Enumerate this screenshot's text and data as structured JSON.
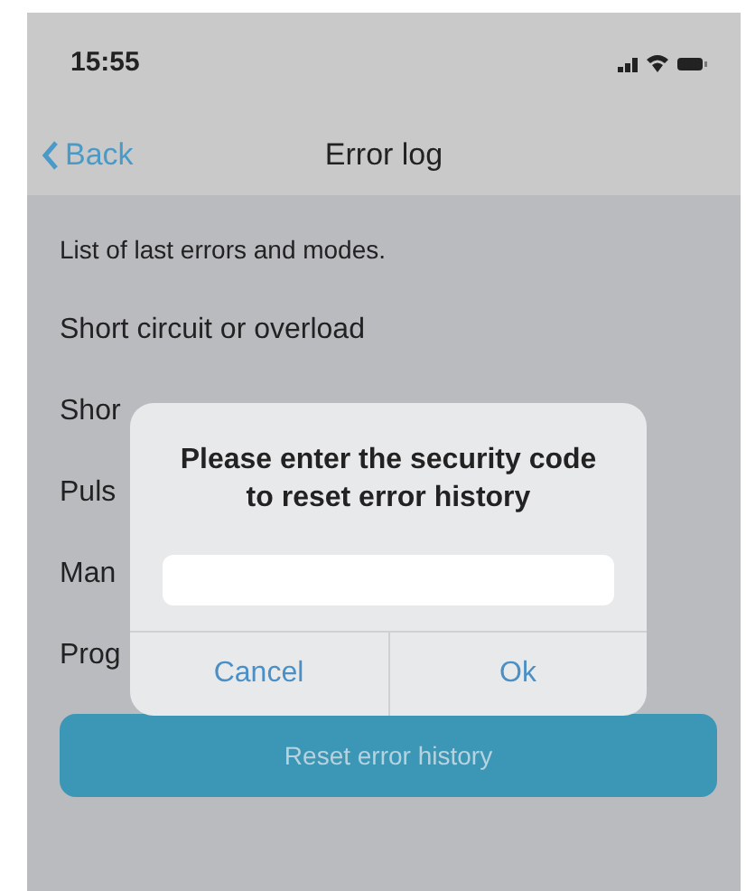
{
  "status_bar": {
    "time": "15:55"
  },
  "nav": {
    "back": "Back",
    "title": "Error log"
  },
  "intro": "List of last errors and modes.",
  "items": [
    {
      "label": "Short circuit or overload"
    },
    {
      "label": "Shor"
    },
    {
      "label": "Puls"
    },
    {
      "label": "Man"
    },
    {
      "label": "Prog"
    }
  ],
  "reset_button": "Reset error history",
  "dialog": {
    "message": "Please enter the security code to reset error history",
    "buttons": [
      {
        "label": "Cancel"
      },
      {
        "label": "Ok"
      }
    ]
  }
}
